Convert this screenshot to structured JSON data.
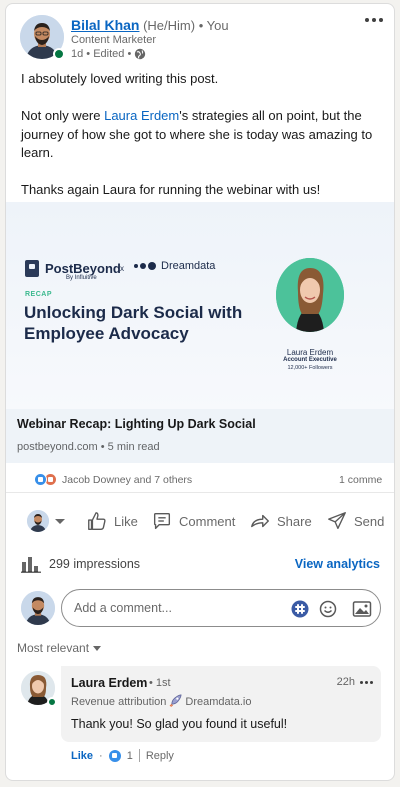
{
  "post": {
    "author": {
      "name": "Bilal Khan",
      "pronouns": "(He/Him)",
      "degree": "• You",
      "headline": "Content Marketer",
      "meta": "1d • Edited •"
    },
    "paragraphs": [
      {
        "before": "I absolutely loved writing this post.",
        "mention": "",
        "after": ""
      },
      {
        "before": "Not only were ",
        "mention": "Laura Erdem",
        "after": "'s strategies all on point, but the journey of how she got to where she is today was amazing to learn."
      },
      {
        "before": "Thanks again Laura for running the webinar with us!",
        "mention": "",
        "after": ""
      }
    ],
    "preview": {
      "brand_left": "PostBeyond",
      "brand_left_sub": "By Influitive",
      "x": "x",
      "brand_right": "Dreamdata",
      "tag": "RECAP",
      "headline": "Unlocking Dark Social with Employee Advocacy",
      "speaker_name": "Laura Erdem",
      "speaker_title": "Account Executive",
      "speaker_followers": "12,000+ Followers",
      "title": "Webinar Recap: Lighting Up Dark Social",
      "subtitle": "postbeyond.com • 5 min read"
    },
    "social": {
      "reactions_text": "Jacob Downey and 7 others",
      "comments_text": "1 comme"
    },
    "actions": {
      "like": "Like",
      "comment": "Comment",
      "share": "Share",
      "send": "Send"
    },
    "analytics": {
      "impressions": "299 impressions",
      "view_label": "View analytics"
    },
    "comment_box": {
      "placeholder": "Add a comment..."
    },
    "sort_label": "Most relevant",
    "comment": {
      "name": "Laura Erdem",
      "degree": "• 1st",
      "headline_prefix": "Revenue attribution",
      "headline_brand": "Dreamdata.io",
      "time": "22h",
      "text": "Thank you! So glad you found it useful!",
      "like_label": "Like",
      "bullet": "·",
      "like_count": "1",
      "reply_label": "Reply"
    }
  },
  "colors": {
    "link": "#0a66c2",
    "presence": "#057642",
    "recap": "#3bb98e",
    "navy": "#1c2b4a"
  }
}
